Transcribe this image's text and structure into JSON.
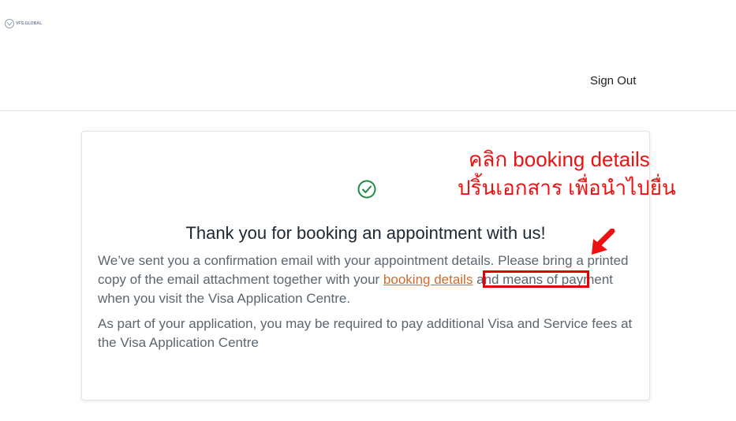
{
  "header": {
    "logo_text": "VFS.GLOBAL",
    "sign_out_label": "Sign Out"
  },
  "confirmation": {
    "icon": "check-circle-icon",
    "title": "Thank you for booking an appointment with us!",
    "para1_before": "We’ve sent you a confirmation email with your appointment details. Please bring a printed copy of the email attachment together with your ",
    "link_label": "booking details",
    "para1_after": " and means of payment when you visit the Visa Application Centre.",
    "para2": "As part of your application, you may be required to pay additional Visa and Service fees at the Visa Application Centre"
  },
  "annotation": {
    "line1": "คลิก booking details",
    "line2": "ปริ้นเอกสาร เพื่อนำไปยื่น"
  },
  "colors": {
    "accent_green": "#1e8a4a",
    "link_orange": "#d06a2a",
    "annotation_red": "#ee1111"
  }
}
